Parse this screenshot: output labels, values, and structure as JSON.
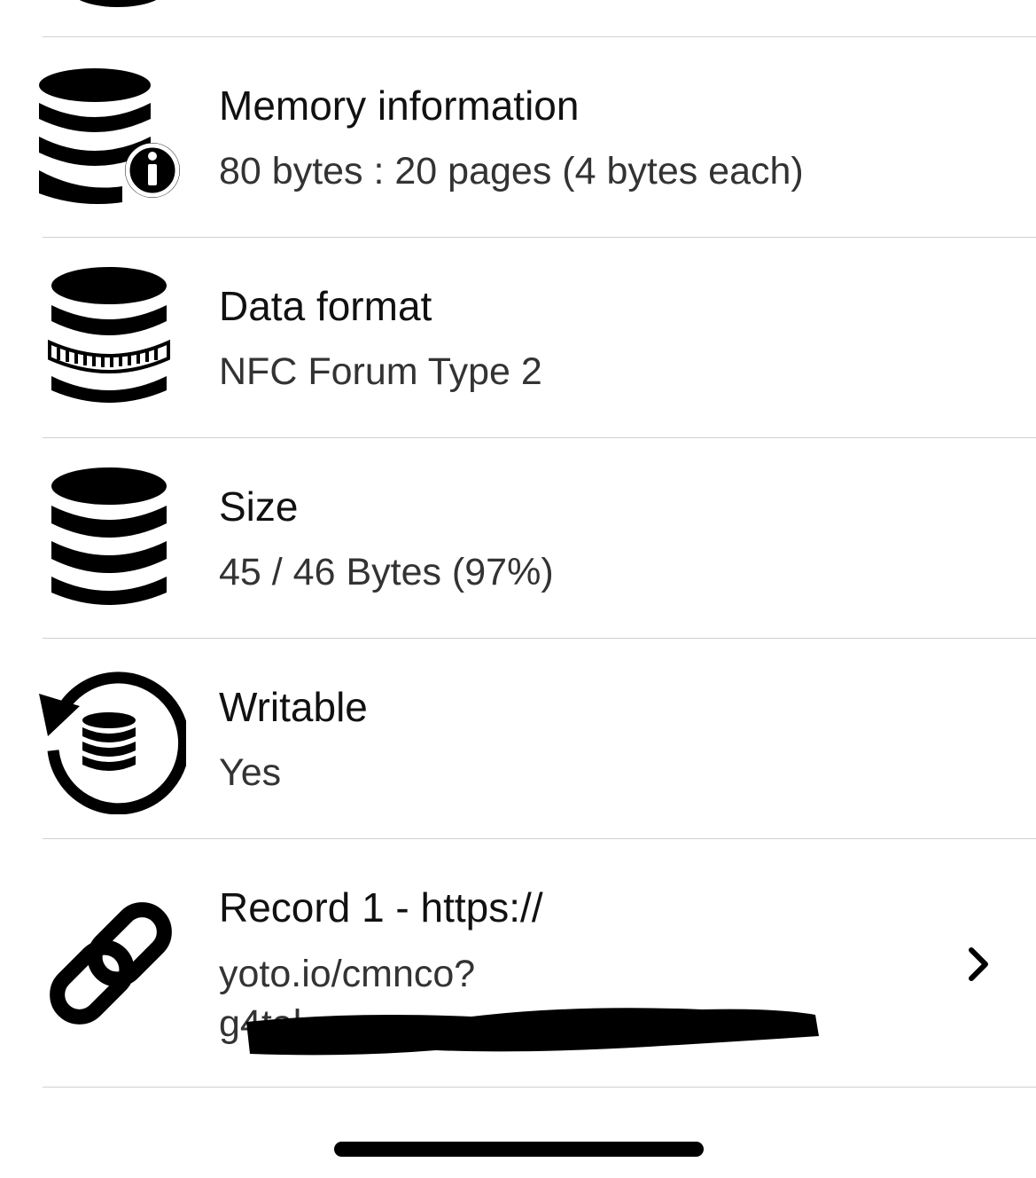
{
  "rows": [
    {
      "icon": "database-info-icon",
      "title": "Memory information",
      "detail": "80 bytes : 20 pages (4 bytes each)"
    },
    {
      "icon": "database-format-icon",
      "title": "Data format",
      "detail": "NFC Forum Type 2"
    },
    {
      "icon": "database-icon",
      "title": "Size",
      "detail": "45 / 46 Bytes (97%)"
    },
    {
      "icon": "database-rewrite-icon",
      "title": "Writable",
      "detail": "Yes"
    },
    {
      "icon": "link-icon",
      "title": "Record 1 - https://",
      "detail_line1": "yoto.io/cmnco?",
      "detail_line2": "g4tal",
      "chevron": "chevron-right-icon"
    }
  ],
  "colors": {
    "background": "#ffffff",
    "text": "#111111",
    "divider": "#d0d0d0",
    "icon": "#000000"
  }
}
